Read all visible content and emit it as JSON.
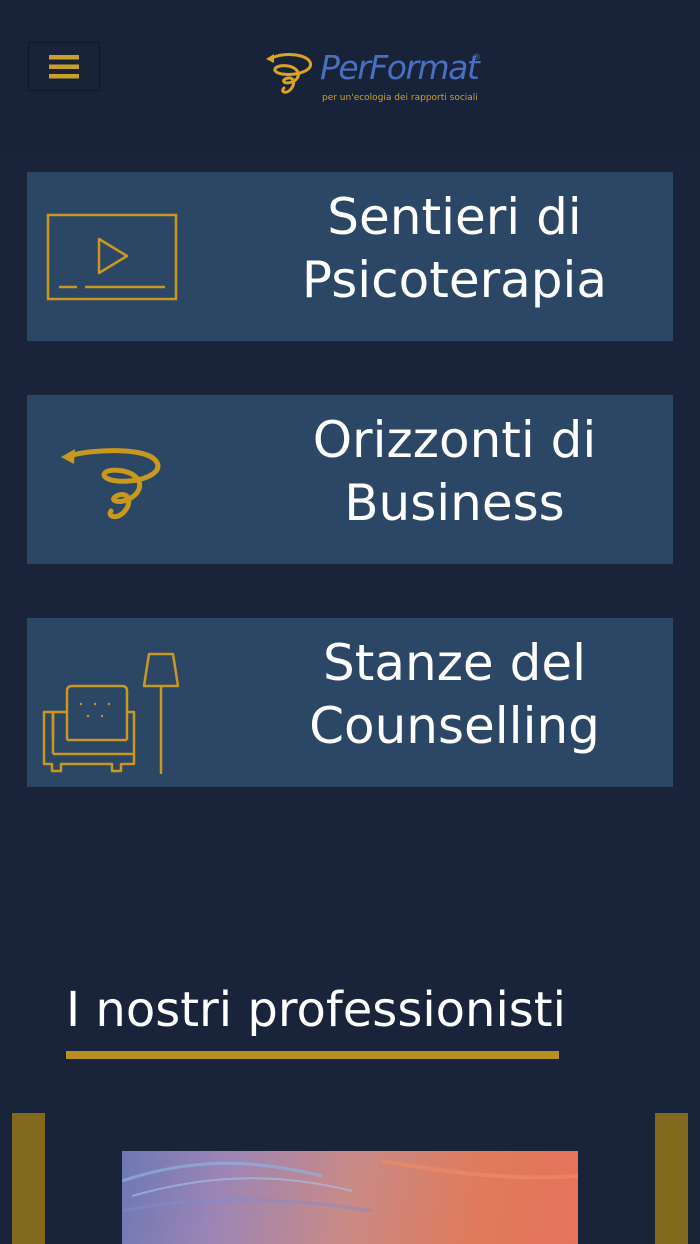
{
  "header": {
    "menu_icon": "hamburger-menu-icon",
    "logo": {
      "name": "PerFormat",
      "registered_mark": "®",
      "tagline": "per un'ecologia dei rapporti sociali",
      "icon": "swirl-logo-icon"
    }
  },
  "sections": [
    {
      "line1": "Sentieri di",
      "line2": "Psicoterapia",
      "icon": "video-player-icon"
    },
    {
      "line1": "Orizzonti di",
      "line2": "Business",
      "icon": "swirl-icon"
    },
    {
      "line1": "Stanze del",
      "line2": "Counselling",
      "icon": "armchair-lamp-icon"
    }
  ],
  "professionals": {
    "heading": "I nostri professionisti",
    "prev_icon": "carousel-prev-icon",
    "next_icon": "carousel-next-icon"
  },
  "colors": {
    "background": "#19243a",
    "card": "#2c4665",
    "accent_gold": "#b8901f",
    "logo_blue": "#4a6fc1"
  }
}
